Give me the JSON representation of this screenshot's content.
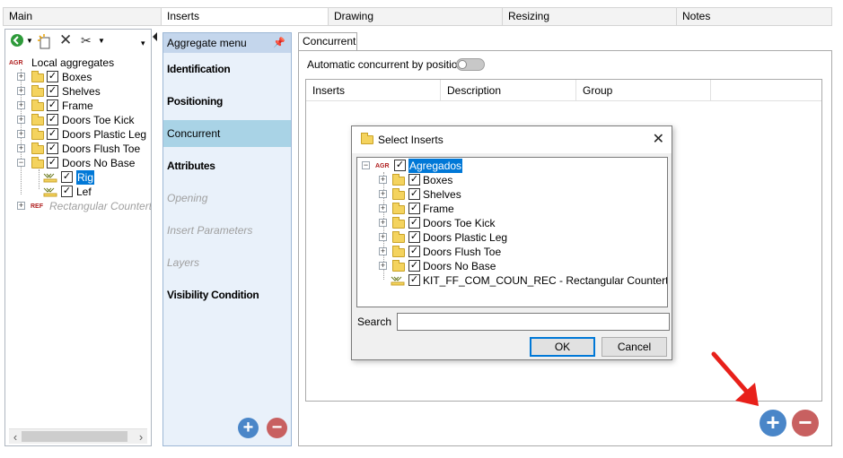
{
  "tabs": [
    "Main",
    "Inserts",
    "Drawing",
    "Resizing",
    "Notes"
  ],
  "left_panel": {
    "root_label": "Local aggregates",
    "root_badge": "AGR",
    "items": [
      "Boxes",
      "Shelves",
      "Frame",
      "Doors Toe Kick",
      "Doors Plastic Leg",
      "Doors Flush Toe",
      "Doors No Base"
    ],
    "sub_items": [
      "Rig",
      "Lef"
    ],
    "ref_badge": "REF",
    "ref_item": "Rectangular Countertop"
  },
  "aggregate_menu": {
    "title": "Aggregate menu",
    "items": [
      {
        "label": "Identification",
        "state": "bold"
      },
      {
        "label": "Positioning",
        "state": "bold"
      },
      {
        "label": "Concurrent",
        "state": "selected"
      },
      {
        "label": "Attributes",
        "state": "bold"
      },
      {
        "label": "Opening",
        "state": "disabled"
      },
      {
        "label": "Insert Parameters",
        "state": "disabled"
      },
      {
        "label": "Layers",
        "state": "disabled"
      },
      {
        "label": "Visibility Condition",
        "state": "bold"
      }
    ]
  },
  "concurrent": {
    "tab_label": "Concurrent",
    "toggle_label": "Automatic concurrent by position",
    "toggle_on": false,
    "columns": [
      "Inserts",
      "Description",
      "Group"
    ]
  },
  "dialog": {
    "title": "Select Inserts",
    "root_label": "Agregados",
    "root_badge": "AGR",
    "items": [
      "Boxes",
      "Shelves",
      "Frame",
      "Doors Toe Kick",
      "Doors Plastic Leg",
      "Doors Flush Toe",
      "Doors No Base"
    ],
    "leaf": "KIT_FF_COM_COUN_REC - Rectangular Countertop",
    "search_label": "Search",
    "search_value": "",
    "ok_label": "OK",
    "cancel_label": "Cancel"
  },
  "colors": {
    "accent_blue": "#4a86c8",
    "remove_red": "#c86060",
    "selection": "#0078d7",
    "menu_selected": "#a9d3e6",
    "arrow_red": "#e8201a"
  }
}
